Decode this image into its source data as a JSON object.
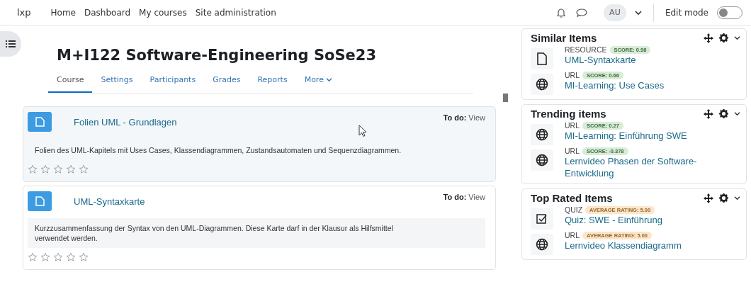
{
  "navbar": {
    "brand": "lxp",
    "links": [
      "Home",
      "Dashboard",
      "My courses",
      "Site administration"
    ],
    "avatar": "AU",
    "edit_mode": {
      "label": "Edit mode",
      "on": false
    }
  },
  "course": {
    "title": "M+I122 Software-Engineering SoSe23",
    "tabs": [
      {
        "label": "Course",
        "selected": true
      },
      {
        "label": "Settings",
        "selected": false
      },
      {
        "label": "Participants",
        "selected": false
      },
      {
        "label": "Grades",
        "selected": false
      },
      {
        "label": "Reports",
        "selected": false
      },
      {
        "label": "More",
        "selected": false
      }
    ],
    "activities": [
      {
        "title": "Folien UML - Grundlagen",
        "todo_label": "To do:",
        "todo_value": "View",
        "description": "Folien des UML-Kapitels mit Uses Cases, Klassendiagrammen, Zustandsautomaten und Sequenzdiagrammen.",
        "stars": 0,
        "highlighted": true
      },
      {
        "title": "UML-Syntaxkarte",
        "todo_label": "To do:",
        "todo_value": "View",
        "description": "Kurzzusammenfassung der Syntax von den UML-Diagrammen. Diese Karte darf in der Klausur als Hilfsmittel verwendet werden.",
        "stars": 0,
        "highlighted": false
      }
    ]
  },
  "blocks": [
    {
      "title": "Similar Items",
      "kind": "score",
      "items": [
        {
          "kind": "file",
          "type": "RESOURCE",
          "badge": "SCORE: 0.98",
          "title": "UML-Syntaxkarte"
        },
        {
          "kind": "url",
          "type": "URL",
          "badge": "SCORE: 0.66",
          "title": "MI-Learning: Use Cases"
        }
      ]
    },
    {
      "title": "Trending items",
      "kind": "score",
      "items": [
        {
          "kind": "url",
          "type": "URL",
          "badge": "SCORE: 0.27",
          "title": "MI-Learning: Einführung SWE"
        },
        {
          "kind": "url",
          "type": "URL",
          "badge": "SCORE: -0.378",
          "title": "Lernvideo Phasen der Software-Entwicklung"
        }
      ]
    },
    {
      "title": "Top Rated Items",
      "kind": "rating",
      "items": [
        {
          "kind": "quiz",
          "type": "QUIZ",
          "badge": "AVERAGE RATING: 5.00",
          "title": "Quiz: SWE - Einführung"
        },
        {
          "kind": "url",
          "type": "URL",
          "badge": "AVERAGE RATING: 5.00",
          "title": "Lernvideo Klassendiagramm"
        }
      ]
    }
  ]
}
